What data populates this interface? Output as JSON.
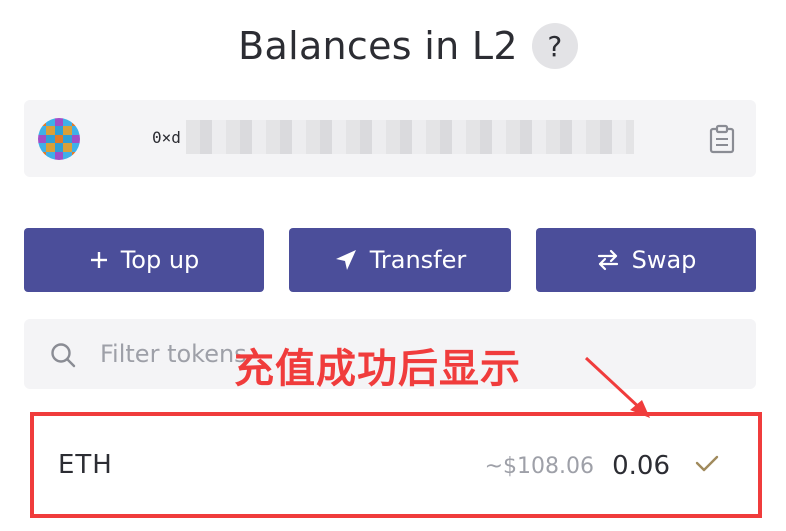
{
  "header": {
    "title": "Balances in L2",
    "help_label": "?"
  },
  "account": {
    "address_prefix": "0×d",
    "copy_icon": "clipboard-icon",
    "avatar_colors": [
      "#e07b2a",
      "#3fb0e8",
      "#a04ec8",
      "#d9a03a",
      "#2f9fd8"
    ]
  },
  "actions": {
    "top_up_label": "Top up",
    "transfer_label": "Transfer",
    "swap_label": "Swap",
    "accent_color": "#4b4e9a"
  },
  "filter": {
    "placeholder": "Filter tokens",
    "value": ""
  },
  "annotation": {
    "text": "充值成功后显示",
    "color": "#f03c3c"
  },
  "tokens": [
    {
      "symbol": "ETH",
      "usd_value": "~$108.06",
      "amount": "0.06",
      "status_icon": "checkmark-icon"
    }
  ]
}
